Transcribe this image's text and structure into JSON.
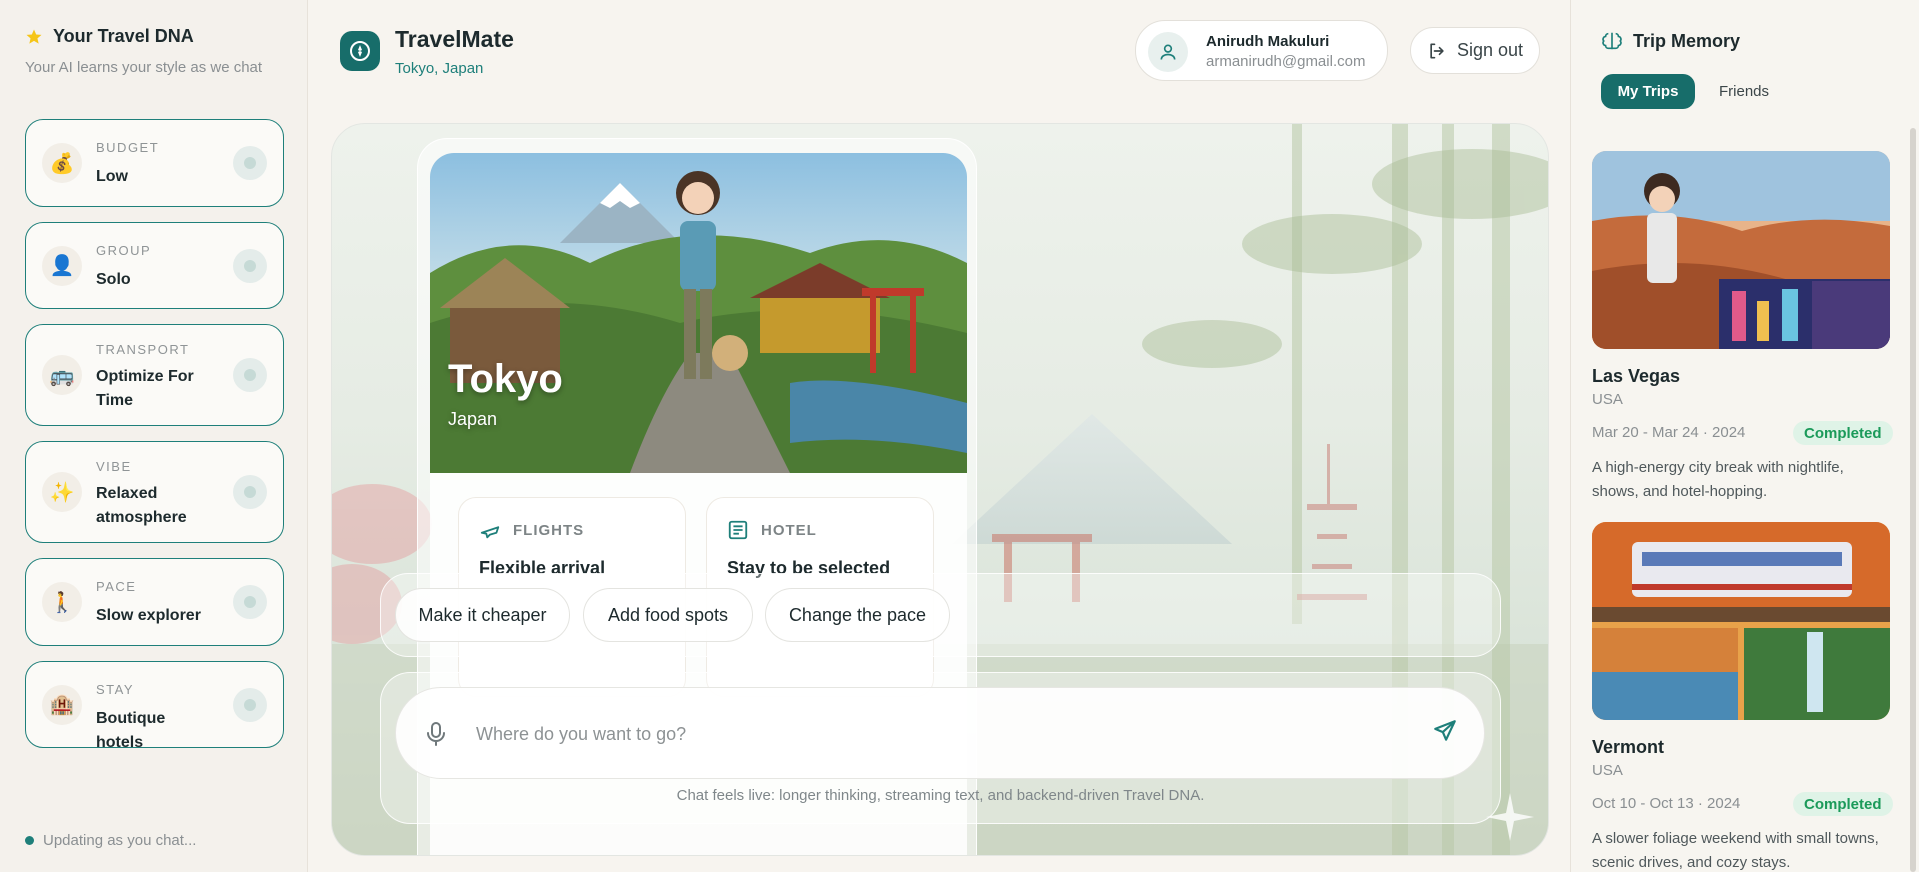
{
  "travel_dna": {
    "title": "Your Travel DNA",
    "subtitle": "Your AI learns your style as we chat",
    "traits": [
      {
        "label": "BUDGET",
        "value": "Low",
        "icon": "money-bag-icon",
        "emoji": "💰"
      },
      {
        "label": "GROUP",
        "value": "Solo",
        "icon": "person-icon",
        "emoji": "👤"
      },
      {
        "label": "TRANSPORT",
        "value": "Optimize For Time",
        "icon": "bus-icon",
        "emoji": "🚌"
      },
      {
        "label": "VIBE",
        "value": "Relaxed atmosphere",
        "icon": "sparkles-icon",
        "emoji": "✨"
      },
      {
        "label": "PACE",
        "value": "Slow explorer",
        "icon": "walking-person-icon",
        "emoji": "🚶"
      },
      {
        "label": "STAY",
        "value": "Boutique hotels",
        "icon": "hotel-icon",
        "emoji": "🏨"
      }
    ],
    "status": "Updating as you chat..."
  },
  "header": {
    "app_name": "TravelMate",
    "location": "Tokyo, Japan",
    "user_name": "Anirudh Makuluri",
    "user_email": "armanirudh@gmail.com",
    "sign_out": "Sign out"
  },
  "destination": {
    "city": "Tokyo",
    "country": "Japan",
    "flights_label": "FLIGHTS",
    "flights_value": "Flexible arrival",
    "hotel_label": "HOTEL",
    "hotel_value": "Stay to be selected"
  },
  "suggestions": [
    "Make it cheaper",
    "Add food spots",
    "Change the pace"
  ],
  "chat": {
    "placeholder": "Where do you want to go?",
    "footnote": "Chat feels live: longer thinking, streaming text, and backend-driven Travel DNA."
  },
  "trip_memory": {
    "title": "Trip Memory",
    "tabs": [
      "My Trips",
      "Friends"
    ],
    "trips": [
      {
        "name": "Las Vegas",
        "country": "USA",
        "dates": "Mar 20 - Mar 24 · 2024",
        "status": "Completed",
        "description": "A high-energy city break with nightlife, shows, and hotel-hopping."
      },
      {
        "name": "Vermont",
        "country": "USA",
        "dates": "Oct 10 - Oct 13 · 2024",
        "status": "Completed",
        "description": "A slower foliage weekend with small towns, scenic drives, and cozy stays."
      }
    ]
  },
  "colors": {
    "accent": "#176d6a",
    "badge_bg": "#dff3e7",
    "badge_text": "#1b9a5a"
  }
}
